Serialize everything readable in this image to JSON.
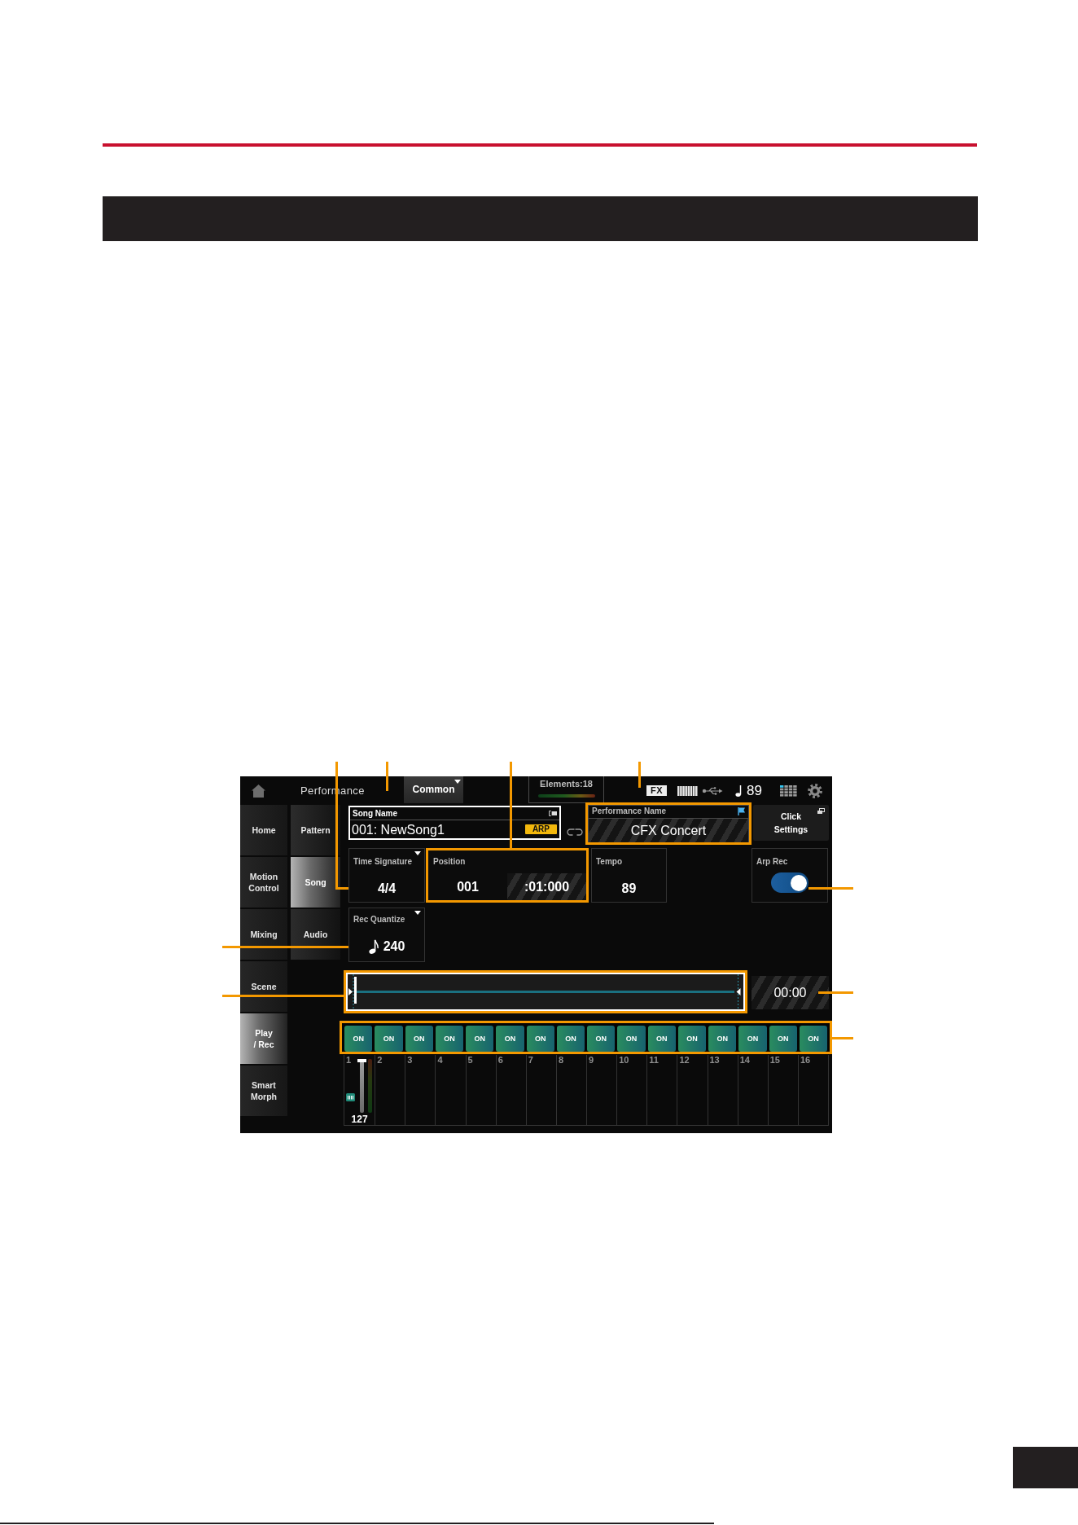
{
  "header": {
    "title": "Performance",
    "part_selector": "Common",
    "elements": "Elements:18",
    "fx": "FX",
    "tempo": "89"
  },
  "sidebar": {
    "main_tabs": [
      {
        "label": "Home",
        "selected": false
      },
      {
        "label": "Motion\nControl",
        "selected": false
      },
      {
        "label": "Mixing",
        "selected": false
      },
      {
        "label": "Scene",
        "selected": false
      },
      {
        "label": "Play\n/ Rec",
        "selected": true
      },
      {
        "label": "Smart\nMorph",
        "selected": false
      }
    ],
    "sub_tabs": [
      {
        "label": "Pattern",
        "selected": false
      },
      {
        "label": "Song",
        "selected": true
      },
      {
        "label": "Audio",
        "selected": false
      }
    ]
  },
  "song": {
    "song_name": {
      "label": "Song Name",
      "value": "001: NewSong1",
      "badge": "ARP",
      "selected": true,
      "callout": true
    },
    "performance_name": {
      "label": "Performance Name",
      "value": "CFX Concert",
      "highlighted": true,
      "callout": true
    },
    "click_settings": {
      "label": "Click\nSettings"
    },
    "time_signature": {
      "label": "Time Signature",
      "value": "4/4",
      "callout": true
    },
    "position": {
      "label": "Position",
      "measure": "001",
      "beat_clock": ":01:000",
      "highlighted": true,
      "callout": true
    },
    "tempo": {
      "label": "Tempo",
      "value": "89"
    },
    "arp_rec": {
      "label": "Arp Rec",
      "on": true,
      "callout": true
    },
    "rec_quantize": {
      "label": "Rec Quantize",
      "value": "240",
      "callout": true
    },
    "timeline": {
      "level": 0,
      "highlighted": true,
      "callout": true
    },
    "elapsed_time": {
      "value": "00:00",
      "callout": true
    },
    "parts": {
      "highlighted": true,
      "callout": true,
      "items": [
        {
          "number": "1",
          "button": "ON",
          "on": true,
          "level": 1,
          "volume": "127"
        },
        {
          "number": "2",
          "button": "ON",
          "on": true
        },
        {
          "number": "3",
          "button": "ON",
          "on": true
        },
        {
          "number": "4",
          "button": "ON",
          "on": true
        },
        {
          "number": "5",
          "button": "ON",
          "on": true
        },
        {
          "number": "6",
          "button": "ON",
          "on": true
        },
        {
          "number": "7",
          "button": "ON",
          "on": true
        },
        {
          "number": "8",
          "button": "ON",
          "on": true
        },
        {
          "number": "9",
          "button": "ON",
          "on": true
        },
        {
          "number": "10",
          "button": "ON",
          "on": true
        },
        {
          "number": "11",
          "button": "ON",
          "on": true
        },
        {
          "number": "12",
          "button": "ON",
          "on": true
        },
        {
          "number": "13",
          "button": "ON",
          "on": true
        },
        {
          "number": "14",
          "button": "ON",
          "on": true
        },
        {
          "number": "15",
          "button": "ON",
          "on": true
        },
        {
          "number": "16",
          "button": "ON",
          "on": true
        }
      ]
    }
  }
}
